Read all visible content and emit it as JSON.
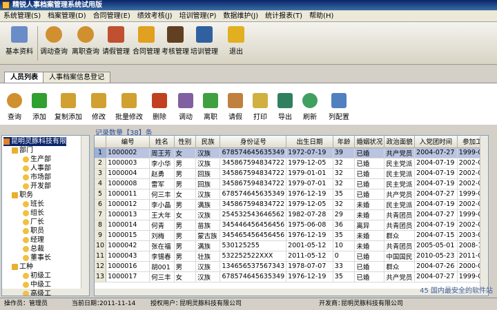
{
  "window": {
    "title": "精锐人事档案管理系统试用版"
  },
  "menu": [
    "系统管理(S)",
    "档案管理(D)",
    "合同管理(E)",
    "绩效考核(J)",
    "培训管理(P)",
    "数据维护(J)",
    "统计报表(T)",
    "帮助(H)"
  ],
  "big_toolbar": [
    {
      "label": "基本资料",
      "icon": "settings-gear-icon"
    },
    {
      "label": "调动查询",
      "icon": "magnifier-icon"
    },
    {
      "label": "离职查询",
      "icon": "magnifier-icon"
    },
    {
      "label": "请假管理",
      "icon": "edit-pencil-icon"
    },
    {
      "label": "合同管理",
      "icon": "puzzle-icon"
    },
    {
      "label": "考核管理",
      "icon": "stamp-icon"
    },
    {
      "label": "培训管理",
      "icon": "books-icon"
    },
    {
      "label": "退出",
      "icon": "runner-exit-icon"
    }
  ],
  "tabs": [
    "人员列表",
    "人事档案信息登记"
  ],
  "small_toolbar": [
    {
      "label": "查询",
      "icon": "magnifier-icon"
    },
    {
      "label": "添加",
      "icon": "plus-icon"
    },
    {
      "label": "复制添加",
      "icon": "pencil-icon"
    },
    {
      "label": "修改",
      "icon": "pencil-icon"
    },
    {
      "label": "批量修改",
      "icon": "pencil-icon"
    },
    {
      "label": "删除",
      "icon": "delete-x-icon"
    },
    {
      "label": "调动",
      "icon": "transfer-icon"
    },
    {
      "label": "离职",
      "icon": "arrow-left-icon"
    },
    {
      "label": "请假",
      "icon": "note-icon"
    },
    {
      "label": "打印",
      "icon": "printer-icon"
    },
    {
      "label": "导出",
      "icon": "export-icon"
    },
    {
      "label": "刷新",
      "icon": "refresh-icon"
    },
    {
      "label": "列配置",
      "icon": "lock-icon"
    }
  ],
  "record_count": "记录数量【38】条",
  "tree": {
    "root": "昆明灵豚科技有限",
    "nodes": [
      {
        "label": "部门",
        "level": 1
      },
      {
        "label": "生产部",
        "level": 2
      },
      {
        "label": "人事部",
        "level": 2
      },
      {
        "label": "市场部",
        "level": 2
      },
      {
        "label": "开发部",
        "level": 2
      },
      {
        "label": "职务",
        "level": 1
      },
      {
        "label": "班长",
        "level": 2
      },
      {
        "label": "组长",
        "level": 2
      },
      {
        "label": "厂长",
        "level": 2
      },
      {
        "label": "职员",
        "level": 2
      },
      {
        "label": "经理",
        "level": 2
      },
      {
        "label": "总裁",
        "level": 2
      },
      {
        "label": "董事长",
        "level": 2
      },
      {
        "label": "工种",
        "level": 1
      },
      {
        "label": "初级工",
        "level": 2
      },
      {
        "label": "中级工",
        "level": 2
      },
      {
        "label": "高级工",
        "level": 2
      }
    ]
  },
  "grid": {
    "columns": [
      "编号",
      "姓名",
      "性别",
      "民族",
      "身份证号",
      "出生日期",
      "年龄",
      "婚姻状况",
      "政治面貌",
      "入党团时间",
      "参加工"
    ],
    "rows": [
      [
        "1",
        "1000002",
        "周王芳",
        "女",
        "汉族",
        "678574645635349",
        "1972-07-19",
        "39",
        "已婚",
        "共产党员",
        "2004-07-27",
        "1999-0"
      ],
      [
        "2",
        "1000003",
        "李小华",
        "男",
        "汉族",
        "345867594834722",
        "1979-12-05",
        "32",
        "已婚",
        "民主党派",
        "2004-07-19",
        "2002-0"
      ],
      [
        "3",
        "1000004",
        "赵勇",
        "男",
        "回族",
        "345867594834722",
        "1979-01-01",
        "32",
        "已婚",
        "民主党派",
        "2004-07-19",
        "2002-0"
      ],
      [
        "4",
        "1000008",
        "雷军",
        "男",
        "回族",
        "345867594834722",
        "1979-07-01",
        "32",
        "已婚",
        "民主党派",
        "2004-07-19",
        "2002-0"
      ],
      [
        "5",
        "1000011",
        "何三丰",
        "女",
        "汉族",
        "678574645635349",
        "1976-12-19",
        "35",
        "已婚",
        "共产党员",
        "2004-07-27",
        "1999-0"
      ],
      [
        "6",
        "1000012",
        "李小晶",
        "男",
        "满族",
        "345867594834722",
        "1979-12-05",
        "32",
        "未婚",
        "民主党派",
        "2004-07-19",
        "2002-0"
      ],
      [
        "7",
        "1000013",
        "王大年",
        "女",
        "汉族",
        "254532543646562",
        "1982-07-28",
        "29",
        "未婚",
        "共青团员",
        "2004-07-27",
        "1999-0"
      ],
      [
        "8",
        "1000014",
        "何青",
        "男",
        "苗族",
        "345446456456456",
        "1975-06-08",
        "36",
        "离异",
        "共青团员",
        "2004-07-19",
        "2002-0"
      ],
      [
        "9",
        "1000015",
        "刘梅",
        "男",
        "蒙古族",
        "345465456456456",
        "1976-12-19",
        "35",
        "未婚",
        "群众",
        "2004-07-15",
        "2003-0"
      ],
      [
        "10",
        "1000042",
        "张在福",
        "男",
        "满族",
        "530125255",
        "2001-05-12",
        "10",
        "未婚",
        "共青团员",
        "2005-05-01",
        "2008-1"
      ],
      [
        "11",
        "1000043",
        "李锡春",
        "男",
        "壮族",
        "532252522XXX",
        "2011-05-12",
        "0",
        "已婚",
        "中国国民",
        "2010-05-23",
        "2011-0"
      ],
      [
        "12",
        "1000016",
        "胡001",
        "男",
        "汉族",
        "134656537567343",
        "1978-07-07",
        "33",
        "已婚",
        "群众",
        "2004-07-26",
        "2000-0"
      ],
      [
        "13",
        "1000017",
        "何三丰",
        "女",
        "汉族",
        "678574645635349",
        "1976-12-19",
        "35",
        "已婚",
        "共产党员",
        "2004-07-27",
        "1999-0"
      ]
    ]
  },
  "status": {
    "operator_label": "操作员：",
    "operator": "管理员",
    "date_label": "当前日期：",
    "date": "2011-11-14",
    "licensee_label": "授权用户：",
    "licensee": "昆明灵豚科技有限公司",
    "developer_label": "开发商：",
    "developer": "昆明灵豚科技有限公司"
  },
  "watermark": [
    "45",
    "国内最安全的软件站"
  ]
}
